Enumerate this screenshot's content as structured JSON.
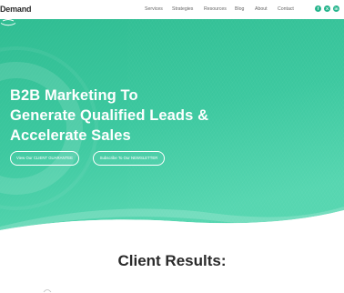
{
  "header": {
    "logo_text": "Demand",
    "nav": [
      {
        "label": "Services"
      },
      {
        "label": "Strategies"
      },
      {
        "label": "Resources"
      },
      {
        "label": "Blog"
      },
      {
        "label": "About"
      },
      {
        "label": "Contact"
      }
    ],
    "social": [
      {
        "icon": "facebook-icon",
        "glyph": "f"
      },
      {
        "icon": "x-twitter-icon",
        "glyph": "X"
      },
      {
        "icon": "linkedin-icon",
        "glyph": "in"
      }
    ]
  },
  "hero": {
    "title_lines": [
      "B2B Marketing To",
      "Generate Qualified Leads &",
      "Accelerate Sales"
    ],
    "buttons": [
      {
        "label": "View Our CLIENT GUARANTEE"
      },
      {
        "label": "Subscribe To Our NEWSLETTER"
      }
    ]
  },
  "results": {
    "title": "Client Results:"
  },
  "colors": {
    "accent": "#25b48c",
    "hero_top": "#2fbd92",
    "hero_bottom": "#4fd4ae",
    "title_text": "#2a2a2a"
  }
}
